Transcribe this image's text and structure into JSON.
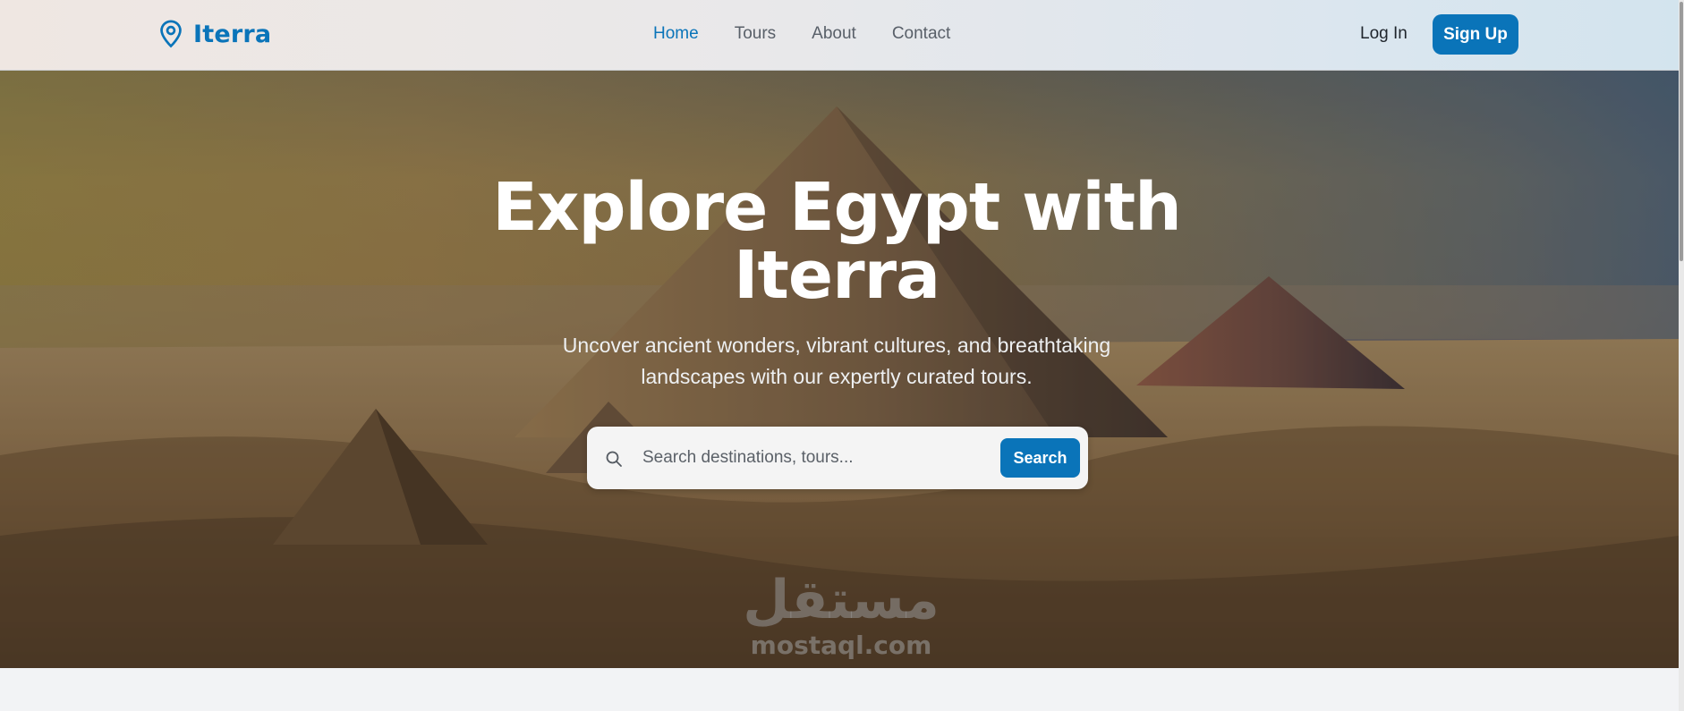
{
  "brand": {
    "name": "Iterra",
    "icon": "map-pin-icon",
    "color": "#0a74b9"
  },
  "nav": {
    "items": [
      {
        "label": "Home",
        "active": true
      },
      {
        "label": "Tours",
        "active": false
      },
      {
        "label": "About",
        "active": false
      },
      {
        "label": "Contact",
        "active": false
      }
    ]
  },
  "auth": {
    "login_label": "Log In",
    "signup_label": "Sign Up"
  },
  "hero": {
    "title": "Explore Egypt with Iterra",
    "subtitle": "Uncover ancient wonders, vibrant cultures, and breathtaking landscapes with our expertly curated tours.",
    "search": {
      "placeholder": "Search destinations, tours...",
      "value": "",
      "button_label": "Search",
      "icon": "search-icon"
    }
  },
  "watermark": {
    "arabic": "مستقل",
    "latin": "mostaql.com"
  },
  "colors": {
    "accent": "#0a74b9",
    "text_dark": "#1f252c",
    "nav_text": "#596069"
  }
}
